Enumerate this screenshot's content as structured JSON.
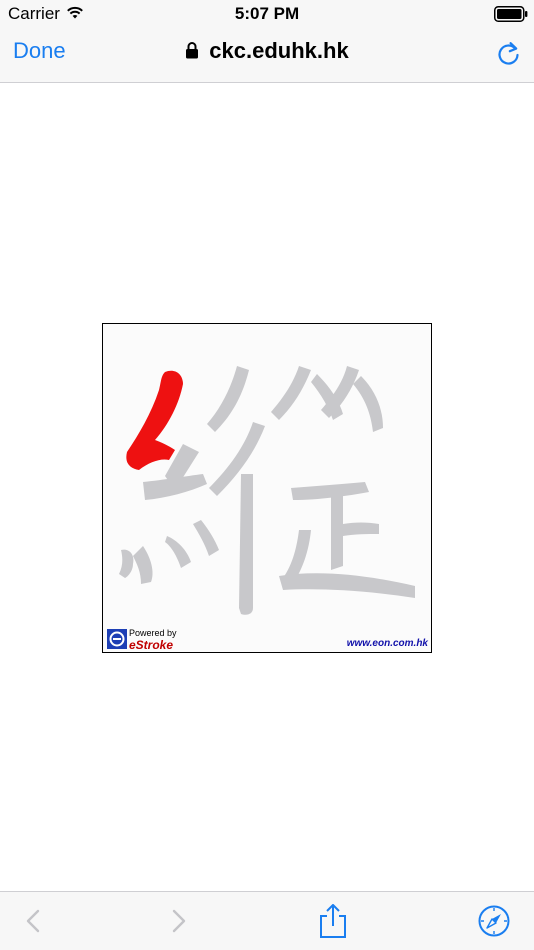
{
  "status_bar": {
    "carrier": "Carrier",
    "time": "5:07 PM",
    "icons": [
      "wifi-icon",
      "battery-icon"
    ]
  },
  "nav": {
    "done_label": "Done",
    "address": "ckc.eduhk.hk",
    "icons": [
      "lock-icon",
      "reload-icon"
    ]
  },
  "content": {
    "stroke_image": {
      "powered_label": "Powered by",
      "brand_label": "eStroke",
      "site_label": "www.eon.com.hk",
      "colors": {
        "active_stroke": "#ee1111",
        "inactive_strokes": "#c8c8cb"
      }
    }
  },
  "toolbar": {
    "icons": [
      "back-chevron-icon",
      "forward-chevron-icon",
      "share-icon",
      "safari-compass-icon"
    ]
  },
  "colors": {
    "accent": "#1a7ef0",
    "bar_background": "#f7f7f7"
  }
}
